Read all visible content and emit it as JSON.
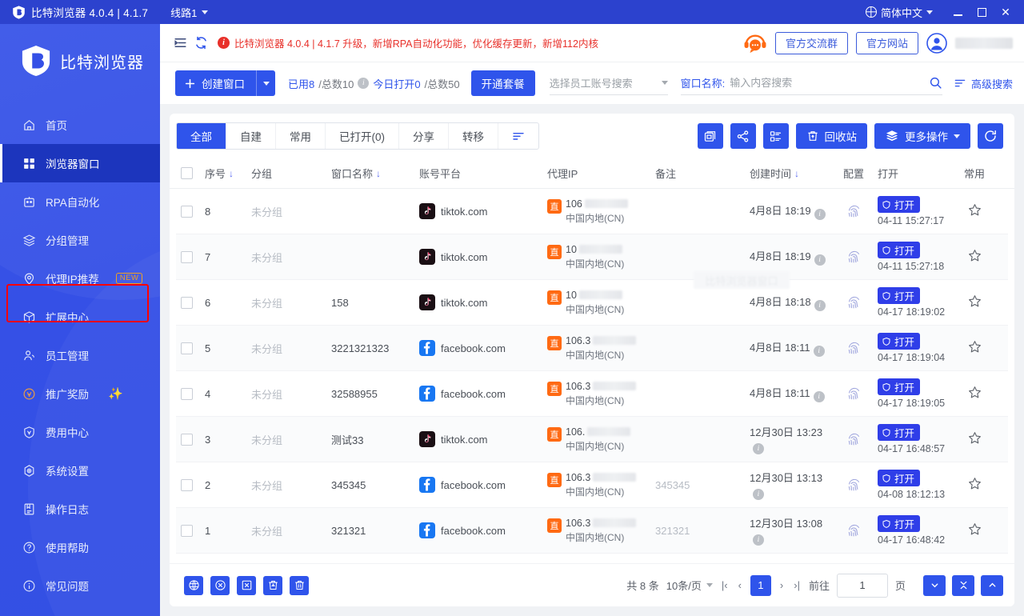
{
  "titlebar": {
    "app_title": "比特浏览器 4.0.4 | 4.1.7",
    "route": "线路1",
    "language": "简体中文",
    "logo_icon": "shield-b-logo-icon",
    "minimize_icon": "minimize-icon",
    "maximize_icon": "maximize-icon",
    "close_icon": "close-icon",
    "close_glyph": "✕"
  },
  "sidebar": {
    "brand": "比特浏览器",
    "items": [
      {
        "label": "首页",
        "icon": "home-icon",
        "active": false
      },
      {
        "label": "浏览器窗口",
        "icon": "grid-icon",
        "active": true
      },
      {
        "label": "RPA自动化",
        "icon": "robot-icon",
        "active": false
      },
      {
        "label": "分组管理",
        "icon": "layers-icon",
        "active": false
      },
      {
        "label": "代理IP推荐",
        "icon": "location-pin-icon",
        "active": false,
        "badge": "NEW",
        "highlighted": true
      },
      {
        "label": "扩展中心",
        "icon": "cube-icon",
        "active": false
      },
      {
        "label": "员工管理",
        "icon": "user-group-icon",
        "active": false
      },
      {
        "label": "推广奖励",
        "icon": "coin-icon",
        "active": false,
        "sparkle": "✦"
      },
      {
        "label": "费用中心",
        "icon": "shield-fee-icon",
        "active": false
      },
      {
        "label": "系统设置",
        "icon": "gear-icon",
        "active": false
      },
      {
        "label": "操作日志",
        "icon": "log-book-icon",
        "active": false
      },
      {
        "label": "使用帮助",
        "icon": "question-circle-icon",
        "active": false
      },
      {
        "label": "常见问题",
        "icon": "info-circle-icon",
        "active": false
      }
    ]
  },
  "topbar": {
    "collapse_icon": "collapse-menu-icon",
    "refresh_icon": "refresh-icon",
    "notice": "比特浏览器 4.0.4 | 4.1.7 升级，新增RPA自动化功能，优化缓存更新，新增112内核",
    "notice_icon": "info-exclaim-icon",
    "chat_icon": "headset-chat-icon",
    "group_button": "官方交流群",
    "website_button": "官方网站",
    "avatar_icon": "user-avatar-icon"
  },
  "toolbar": {
    "create_label": "创建窗口",
    "create_plus_icon": "plus-icon",
    "create_dropdown_icon": "chevron-down-icon",
    "used_label": "已用8",
    "used_total": "/总数10",
    "today_open": "今日打开0",
    "today_total": "/总数50",
    "package_button": "开通套餐",
    "staff_select_placeholder": "选择员工账号搜索",
    "search_label": "窗口名称:",
    "search_placeholder": "输入内容搜索",
    "search_value": "",
    "search_icon": "search-icon",
    "advanced_search": "高级搜索",
    "filter_icon": "filter-icon"
  },
  "tabs": [
    {
      "label": "全部",
      "active": true
    },
    {
      "label": "自建",
      "active": false
    },
    {
      "label": "常用",
      "active": false
    },
    {
      "label": "已打开(0)",
      "active": false
    },
    {
      "label": "分享",
      "active": false
    },
    {
      "label": "转移",
      "active": false
    },
    {
      "label": "",
      "icon": "sort-lines-icon",
      "active": false
    }
  ],
  "actions": {
    "save_icon": "save-windows-icon",
    "share_icon": "share-icon",
    "list_icon": "list-settings-icon",
    "recycle_label": "回收站",
    "recycle_icon": "recycle-bin-icon",
    "more_label": "更多操作",
    "more_icon": "layers-stack-icon",
    "more_caret_icon": "chevron-down-icon",
    "refresh_icon": "refresh-circle-icon"
  },
  "table": {
    "watermark": "比特浏览器窗口",
    "columns": [
      {
        "key": "checkbox",
        "label": ""
      },
      {
        "key": "no",
        "label": "序号",
        "sort": "↓"
      },
      {
        "key": "group",
        "label": "分组"
      },
      {
        "key": "name",
        "label": "窗口名称",
        "sort": "↓"
      },
      {
        "key": "platform",
        "label": "账号平台"
      },
      {
        "key": "ip",
        "label": "代理IP"
      },
      {
        "key": "note",
        "label": "备注"
      },
      {
        "key": "created",
        "label": "创建时间",
        "sort": "↓"
      },
      {
        "key": "config",
        "label": "配置"
      },
      {
        "key": "open",
        "label": "打开"
      },
      {
        "key": "fav",
        "label": "常用"
      }
    ],
    "rows": [
      {
        "no": "8",
        "group": "未分组",
        "name": "",
        "platform": "tiktok.com",
        "platform_icon": "tiktok-icon",
        "ip_prefix": "106",
        "ip_badge": "直",
        "ip_region": "中国内地(CN)",
        "note": "",
        "created": "4月8日 18:19",
        "config_icon": "fingerprint-icon",
        "open_label": "打开",
        "open_icon": "shield-open-icon",
        "open_time": "04-11 15:27:17",
        "fav_icon": "star-outline-icon"
      },
      {
        "no": "7",
        "group": "未分组",
        "name": "",
        "platform": "tiktok.com",
        "platform_icon": "tiktok-icon",
        "ip_prefix": "10",
        "ip_badge": "直",
        "ip_region": "中国内地(CN)",
        "note": "",
        "created": "4月8日 18:19",
        "config_icon": "fingerprint-icon",
        "open_label": "打开",
        "open_icon": "shield-open-icon",
        "open_time": "04-11 15:27:18",
        "fav_icon": "star-outline-icon"
      },
      {
        "no": "6",
        "group": "未分组",
        "name": "158",
        "platform": "tiktok.com",
        "platform_icon": "tiktok-icon",
        "ip_prefix": "10",
        "ip_badge": "直",
        "ip_region": "中国内地(CN)",
        "note": "",
        "created": "4月8日 18:18",
        "config_icon": "fingerprint-icon",
        "open_label": "打开",
        "open_icon": "shield-open-icon",
        "open_time": "04-17 18:19:02",
        "fav_icon": "star-outline-icon"
      },
      {
        "no": "5",
        "group": "未分组",
        "name": "3221321323",
        "platform": "facebook.com",
        "platform_icon": "facebook-icon",
        "ip_prefix": "106.3",
        "ip_badge": "直",
        "ip_region": "中国内地(CN)",
        "note": "",
        "created": "4月8日 18:11",
        "config_icon": "fingerprint-icon",
        "open_label": "打开",
        "open_icon": "shield-open-icon",
        "open_time": "04-17 18:19:04",
        "fav_icon": "star-outline-icon"
      },
      {
        "no": "4",
        "group": "未分组",
        "name": "32588955",
        "platform": "facebook.com",
        "platform_icon": "facebook-icon",
        "ip_prefix": "106.3",
        "ip_badge": "直",
        "ip_region": "中国内地(CN)",
        "note": "",
        "created": "4月8日 18:11",
        "config_icon": "fingerprint-icon",
        "open_label": "打开",
        "open_icon": "shield-open-icon",
        "open_time": "04-17 18:19:05",
        "fav_icon": "star-outline-icon"
      },
      {
        "no": "3",
        "group": "未分组",
        "name": "测试33",
        "platform": "tiktok.com",
        "platform_icon": "tiktok-icon",
        "ip_prefix": "106.",
        "ip_badge": "直",
        "ip_region": "中国内地(CN)",
        "note": "",
        "created": "12月30日 13:23",
        "config_icon": "fingerprint-icon",
        "open_label": "打开",
        "open_icon": "shield-open-icon",
        "open_time": "04-17 16:48:57",
        "fav_icon": "star-outline-icon"
      },
      {
        "no": "2",
        "group": "未分组",
        "name": "345345",
        "platform": "facebook.com",
        "platform_icon": "facebook-icon",
        "ip_prefix": "106.3",
        "ip_badge": "直",
        "ip_region": "中国内地(CN)",
        "note": "345345",
        "created": "12月30日 13:13",
        "config_icon": "fingerprint-icon",
        "open_label": "打开",
        "open_icon": "shield-open-icon",
        "open_time": "04-08 18:12:13",
        "fav_icon": "star-outline-icon"
      },
      {
        "no": "1",
        "group": "未分组",
        "name": "321321",
        "platform": "facebook.com",
        "platform_icon": "facebook-icon",
        "ip_prefix": "106.3",
        "ip_badge": "直",
        "ip_region": "中国内地(CN)",
        "note": "321321",
        "created": "12月30日 13:08",
        "config_icon": "fingerprint-icon",
        "open_label": "打开",
        "open_icon": "shield-open-icon",
        "open_time": "04-17 16:48:42",
        "fav_icon": "star-outline-icon"
      }
    ]
  },
  "footer": {
    "icons": [
      {
        "name": "browser-fingerprint-icon"
      },
      {
        "name": "close-all-icon"
      },
      {
        "name": "export-excel-icon"
      },
      {
        "name": "recycle-icon"
      },
      {
        "name": "delete-icon"
      }
    ],
    "total_label": "共 8 条",
    "page_size": "10条/页",
    "first_page_icon": "first-page-icon",
    "prev_page_icon": "prev-page-icon",
    "current_page": "1",
    "next_page_icon": "next-page-icon",
    "last_page_icon": "last-page-icon",
    "goto_label": "前往",
    "goto_value": "1",
    "page_unit": "页",
    "down_icon": "chevron-down-icon",
    "collapse_icon": "collapse-vertical-icon",
    "up_icon": "chevron-up-icon"
  },
  "colors": {
    "brand_blue": "#2f54eb",
    "titlebar_blue": "#2c42ce",
    "sidebar_blue": "#3550e6",
    "active_nav": "#1c35bd",
    "notice_red": "#e8302a",
    "badge_orange": "#f0a020",
    "highlight_red": "#ff0000",
    "ip_badge_orange": "#ff6a13"
  }
}
